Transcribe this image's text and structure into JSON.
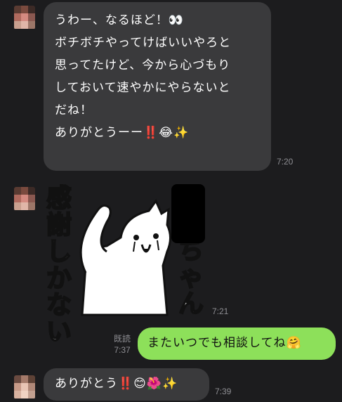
{
  "thread": {
    "msg1": {
      "lines": [
        "うわー、なるほど！👀",
        "",
        "ボチボチやってけばいいやろと",
        "思ってたけど、今から心づもり",
        "しておいて速やかにやらないと",
        "だね！",
        "",
        "ありがとうーー‼️😂✨"
      ],
      "time": "7:20"
    },
    "sticker": {
      "left_text": [
        "感",
        "謝",
        "し",
        "か",
        "な",
        "い"
      ],
      "right_text": [
        "ち",
        "ゃ",
        "ん"
      ],
      "time": "7:21"
    },
    "msg_mine": {
      "text": "またいつでも相談してね🤗",
      "read_label": "既読",
      "time": "7:37"
    },
    "msg3": {
      "text": "ありがとう‼️😊🌺✨",
      "time": "7:39"
    }
  },
  "colors": {
    "background": "#1c1c1e",
    "incoming_bubble": "#3a3a3c",
    "outgoing_bubble": "#8de05a"
  }
}
